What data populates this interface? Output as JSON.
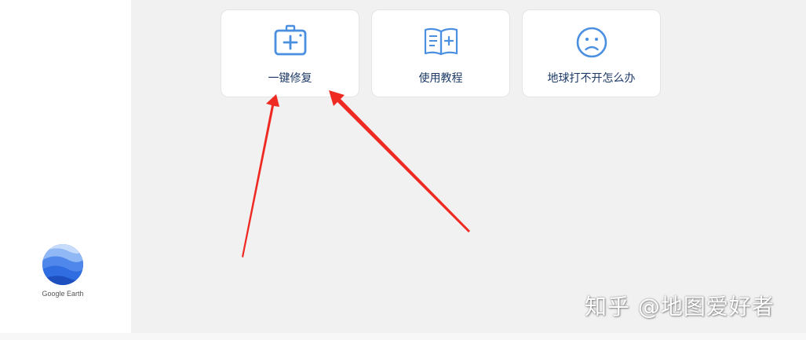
{
  "sidebar": {
    "logo": {
      "icon": "google-earth-icon",
      "text": "Google Earth"
    }
  },
  "cards": [
    {
      "label": "一键修复",
      "icon": "first-aid-kit-icon"
    },
    {
      "label": "使用教程",
      "icon": "open-book-icon"
    },
    {
      "label": "地球打不开怎么办",
      "icon": "sad-face-icon"
    }
  ],
  "watermark": "知乎 @地图爱好者",
  "colors": {
    "accent": "#4a8fe0",
    "label": "#1d3a66",
    "arrow": "#ee2a22",
    "background": "#f1f1f1"
  }
}
